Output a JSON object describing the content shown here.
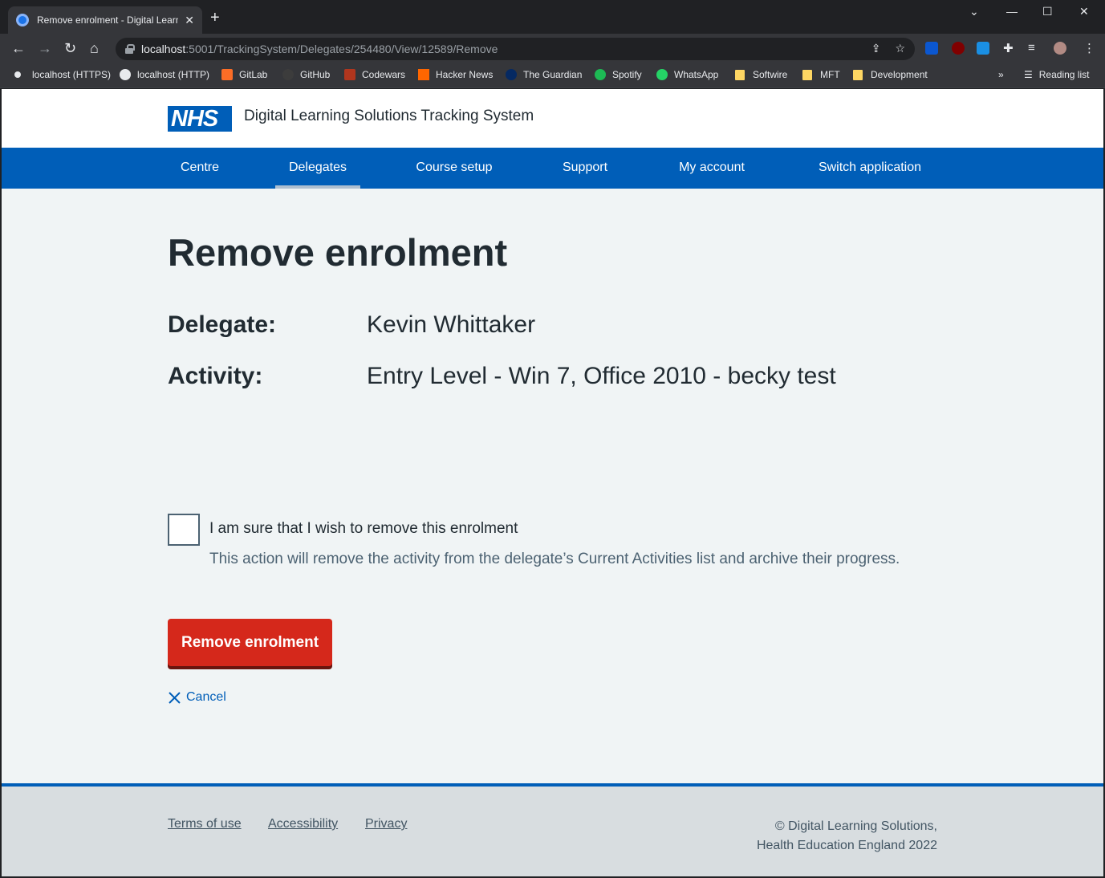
{
  "browser": {
    "tab_title": "Remove enrolment - Digital Learn",
    "url_host": "localhost",
    "url_path": ":5001/TrackingSystem/Delegates/254480/View/12589/Remove",
    "bookmarks": [
      {
        "label": "localhost (HTTPS)",
        "color": "#e8eaed"
      },
      {
        "label": "localhost (HTTP)",
        "color": "#e8eaed"
      },
      {
        "label": "GitLab",
        "color": "#fc6d26"
      },
      {
        "label": "GitHub",
        "color": "#202124"
      },
      {
        "label": "Codewars",
        "color": "#b1361e"
      },
      {
        "label": "Hacker News",
        "color": "#ff6600"
      },
      {
        "label": "The Guardian",
        "color": "#052962"
      },
      {
        "label": "Spotify",
        "color": "#1db954"
      },
      {
        "label": "WhatsApp",
        "color": "#25d366"
      },
      {
        "label": "Softwire",
        "color": "#fdd663"
      },
      {
        "label": "MFT",
        "color": "#fdd663"
      },
      {
        "label": "Development",
        "color": "#fdd663"
      }
    ],
    "reading_list": "Reading list",
    "overflow": "»"
  },
  "header": {
    "logo": "NHS",
    "service_name": "Digital Learning Solutions Tracking System"
  },
  "nav": {
    "items": [
      {
        "label": "Centre"
      },
      {
        "label": "Delegates"
      },
      {
        "label": "Course setup"
      },
      {
        "label": "Support"
      },
      {
        "label": "My account"
      },
      {
        "label": "Switch application"
      }
    ],
    "active": "Delegates"
  },
  "main": {
    "title": "Remove enrolment",
    "delegate_key": "Delegate:",
    "delegate_value": "Kevin Whittaker",
    "activity_key": "Activity:",
    "activity_value": "Entry Level - Win 7, Office 2010 - becky test",
    "checkbox_label": "I am sure that I wish to remove this enrolment",
    "checkbox_checked": false,
    "checkbox_hint": "This action will remove the activity from the delegate’s Current Activities list and archive their progress.",
    "submit_label": "Remove enrolment",
    "cancel_label": "Cancel"
  },
  "footer": {
    "links": [
      {
        "label": "Terms of use"
      },
      {
        "label": "Accessibility"
      },
      {
        "label": "Privacy"
      }
    ],
    "copyright_line1": "© Digital Learning Solutions,",
    "copyright_line2": "Health Education England 2022"
  },
  "colors": {
    "nhs_blue": "#005eb8",
    "warning_red": "#d5281b",
    "page_bg": "#f0f4f5",
    "text": "#212b32"
  }
}
